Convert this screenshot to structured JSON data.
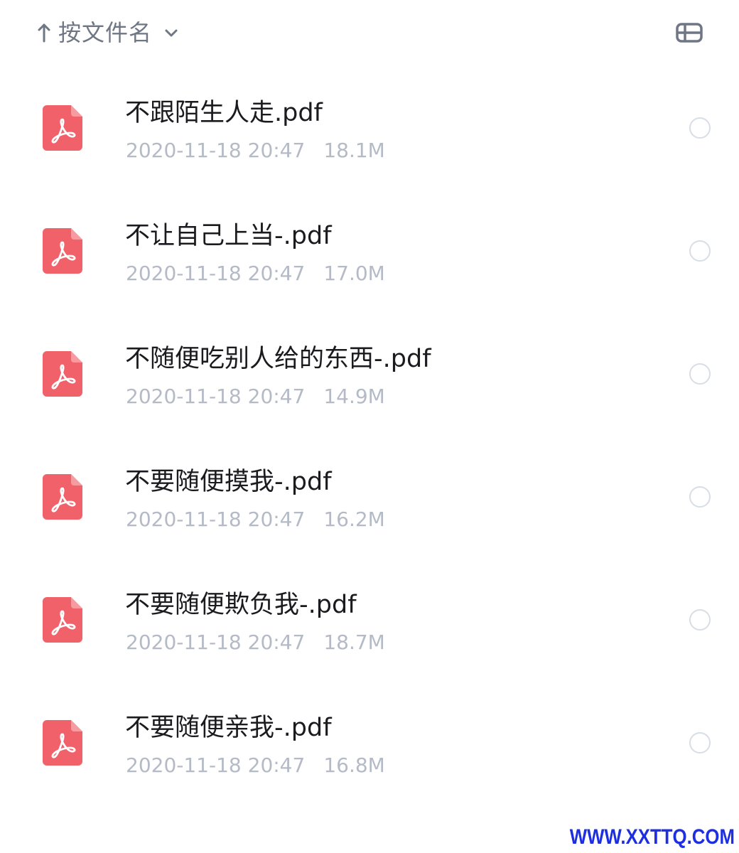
{
  "sort": {
    "arrow_icon": "arrow-up-icon",
    "label": "按文件名",
    "chevron_icon": "chevron-down-icon"
  },
  "view_toggle": {
    "icon": "list-view-icon"
  },
  "files": [
    {
      "name": "不跟陌生人走.pdf",
      "date": "2020-11-18 20:47",
      "size": "18.1M",
      "icon": "pdf-icon"
    },
    {
      "name": "不让自己上当-.pdf",
      "date": "2020-11-18 20:47",
      "size": "17.0M",
      "icon": "pdf-icon"
    },
    {
      "name": "不随便吃别人给的东西-.pdf",
      "date": "2020-11-18 20:47",
      "size": "14.9M",
      "icon": "pdf-icon"
    },
    {
      "name": "不要随便摸我-.pdf",
      "date": "2020-11-18 20:47",
      "size": "16.2M",
      "icon": "pdf-icon"
    },
    {
      "name": "不要随便欺负我-.pdf",
      "date": "2020-11-18 20:47",
      "size": "18.7M",
      "icon": "pdf-icon"
    },
    {
      "name": "不要随便亲我-.pdf",
      "date": "2020-11-18 20:47",
      "size": "16.8M",
      "icon": "pdf-icon"
    }
  ],
  "watermark": "WWW.XXTTQ.COM",
  "colors": {
    "pdf_icon": "#f0616a",
    "secondary_text": "#b4bac6",
    "primary_text": "#1b1b1f",
    "watermark": "#1d2fe0"
  }
}
